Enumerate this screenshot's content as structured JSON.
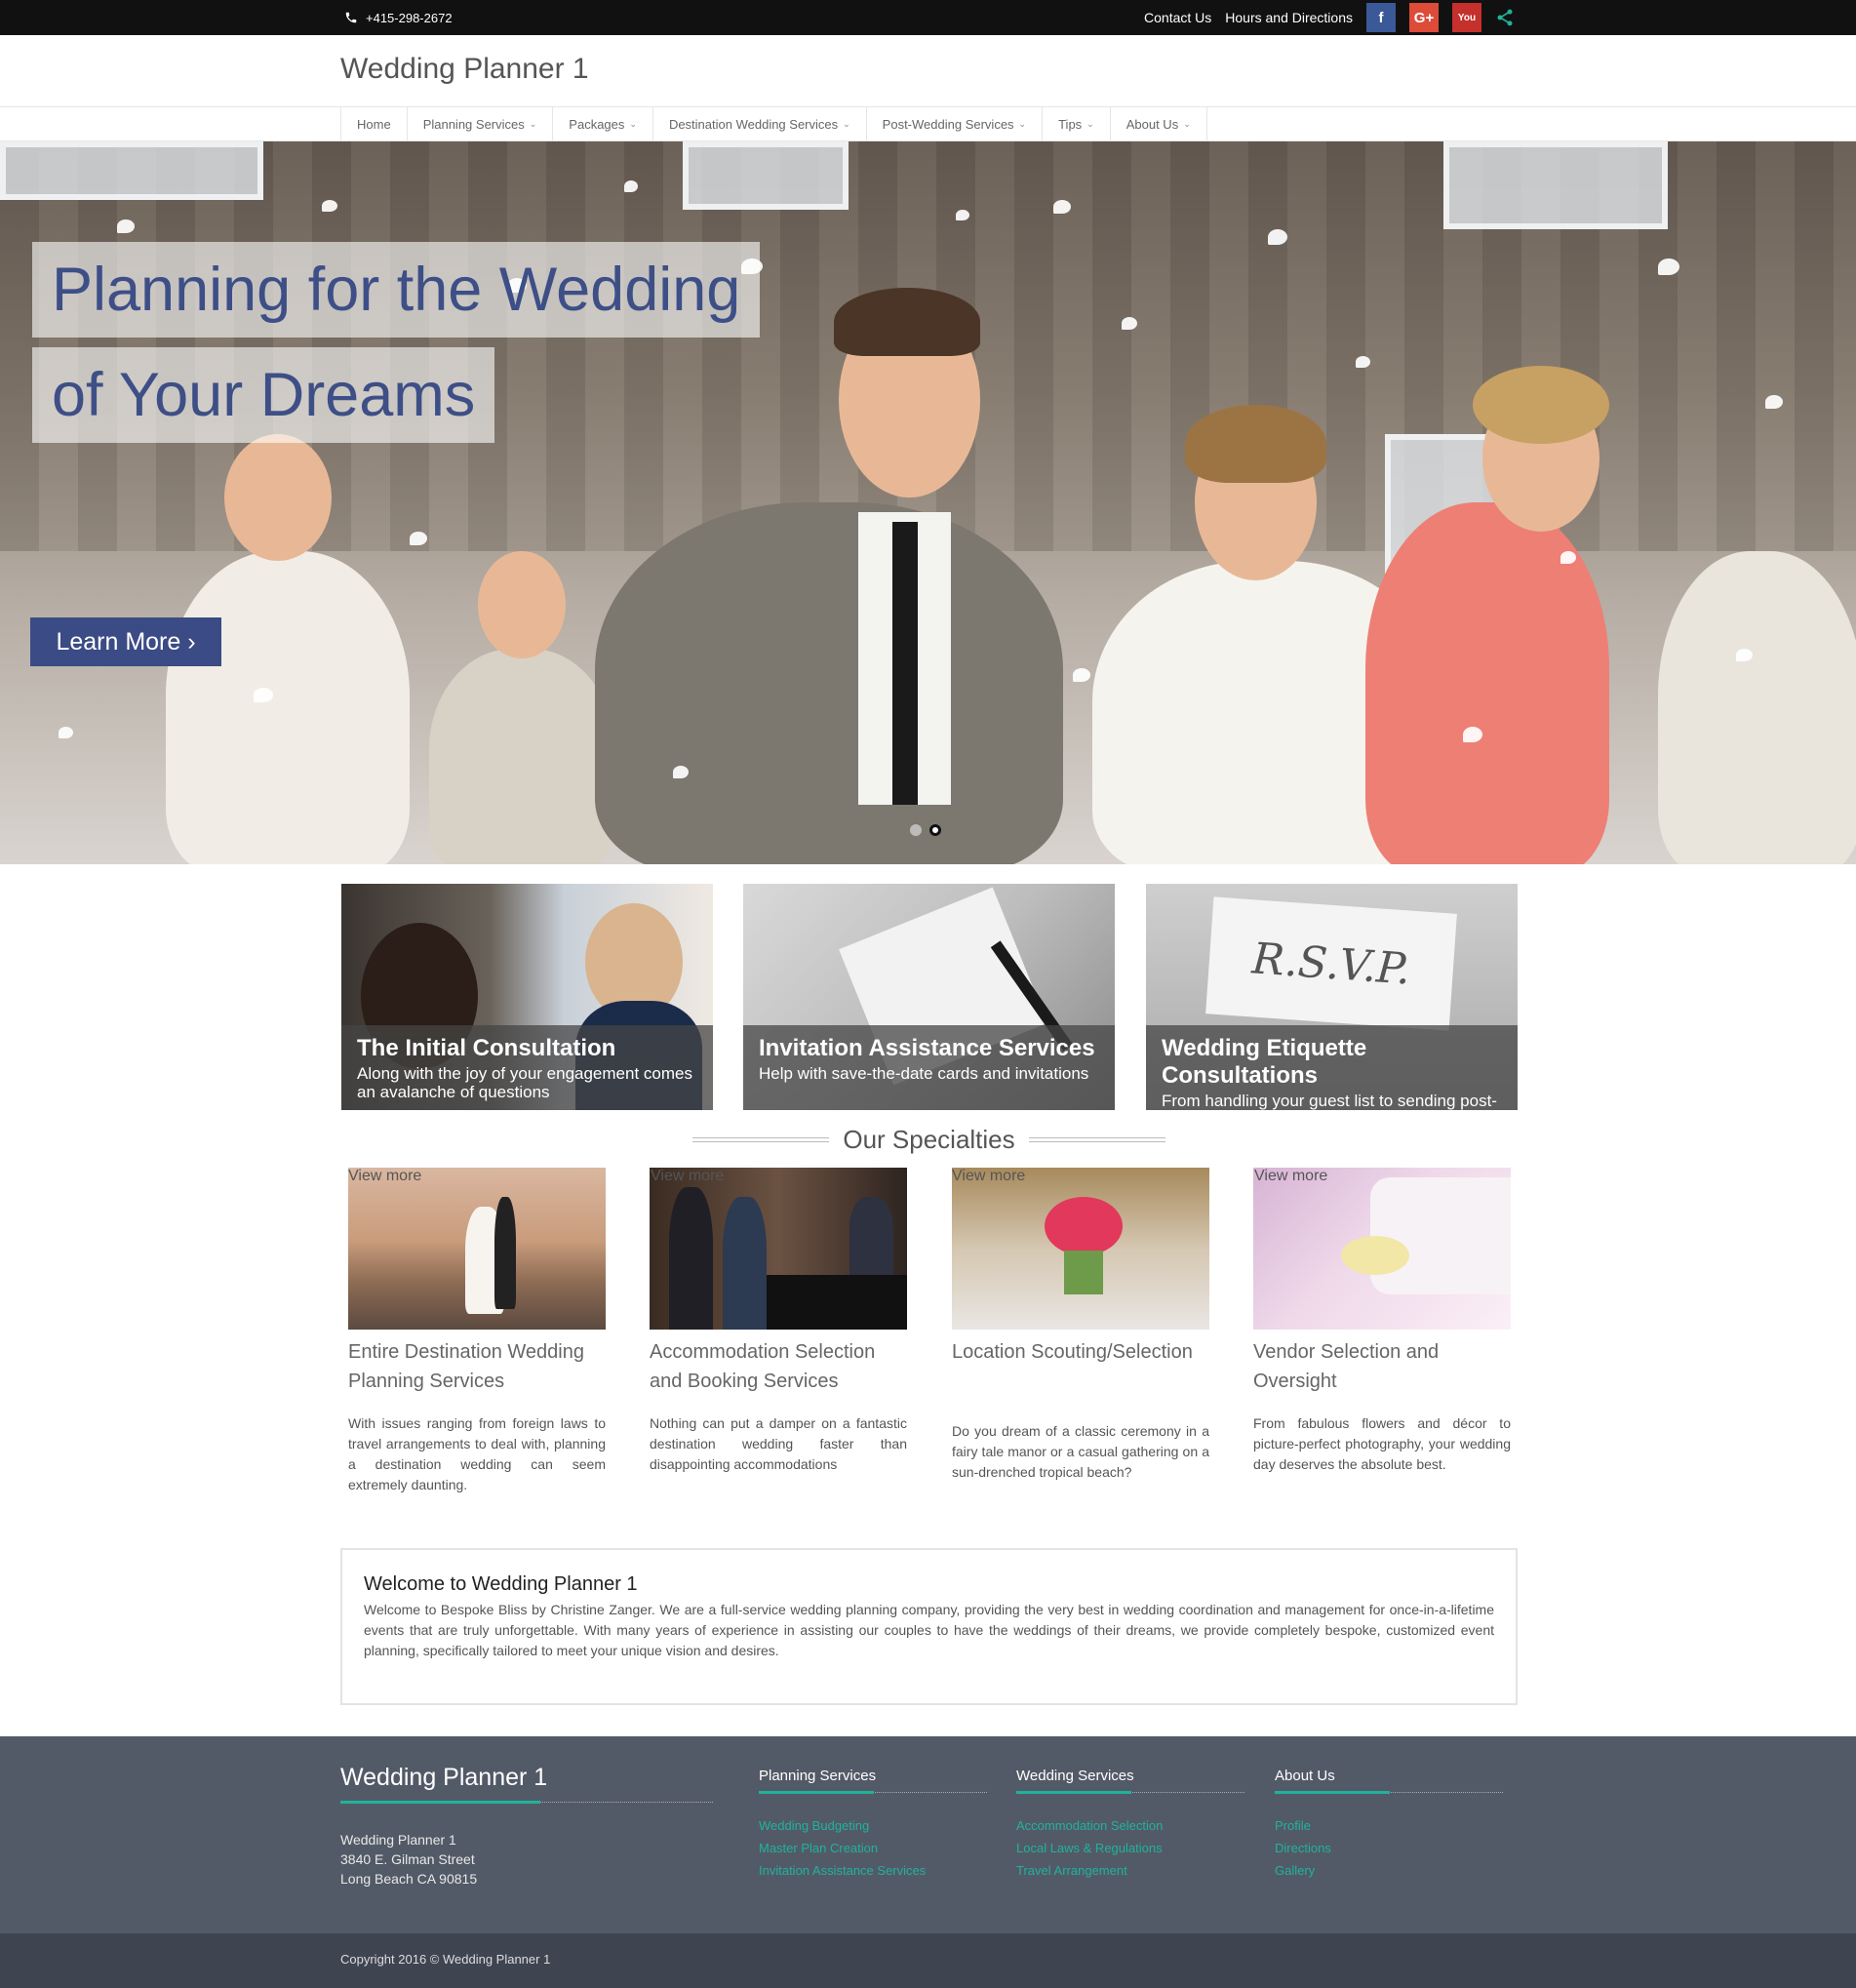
{
  "topbar": {
    "phone": "+415-298-2672",
    "links": [
      "Contact Us",
      "Hours and Directions"
    ],
    "social": {
      "facebook": "f",
      "google": "G+",
      "youtube": "You"
    }
  },
  "header": {
    "logo": "Wedding Planner 1"
  },
  "nav": [
    {
      "label": "Home",
      "dropdown": false
    },
    {
      "label": "Planning Services",
      "dropdown": true
    },
    {
      "label": "Packages",
      "dropdown": true
    },
    {
      "label": "Destination Wedding Services",
      "dropdown": true
    },
    {
      "label": "Post-Wedding Services",
      "dropdown": true
    },
    {
      "label": "Tips",
      "dropdown": true
    },
    {
      "label": "About Us",
      "dropdown": true
    }
  ],
  "hero": {
    "line1": "Planning for the Wedding",
    "line2": "of Your Dreams",
    "button": "Learn More ›"
  },
  "features": [
    {
      "title": "The Initial Consultation",
      "desc": "Along with the joy of your engagement comes an avalanche of questions"
    },
    {
      "title": "Invitation Assistance Services",
      "desc": "Help with save-the-date cards and invitations"
    },
    {
      "title": "Wedding Etiquette Consultations",
      "desc": "From handling your guest list to sending post-wedding thank you cards"
    }
  ],
  "rsvp_text": "R.S.V.P.",
  "specialties": {
    "title": "Our Specialties",
    "items": [
      {
        "title": "Entire Destination Wedding Planning Services",
        "desc": "With issues ranging from foreign laws to travel arrangements to deal with, planning a destination wedding can seem extremely daunting.",
        "button": "View more"
      },
      {
        "title": "Accommodation Selection and Booking Services",
        "desc": "Nothing can put a damper on a fantastic destination wedding faster than disappointing accommodations",
        "button": "View more"
      },
      {
        "title": "Location Scouting/Selection",
        "desc": "Do you dream of a classic ceremony in a fairy tale manor or a casual gathering on a sun-drenched tropical beach?",
        "button": "View more"
      },
      {
        "title": "Vendor Selection and Oversight",
        "desc": "From fabulous flowers and décor to picture-perfect photography, your wedding day deserves the absolute best.",
        "button": "View more"
      }
    ]
  },
  "welcome": {
    "title": "Welcome to Wedding Planner 1",
    "text": "Welcome to Bespoke Bliss by Christine Zanger. We are a full-service wedding planning company, providing the very best in wedding coordination and management for once-in-a-lifetime events that are truly unforgettable.  With many years of experience in assisting our couples to have the weddings of their dreams, we provide completely bespoke, customized event planning, specifically tailored to meet your unique vision and desires."
  },
  "footer": {
    "brand": "Wedding Planner 1",
    "address": [
      "Wedding Planner 1",
      "3840 E. Gilman Street",
      "Long Beach CA 90815"
    ],
    "columns": [
      {
        "title": "Planning Services",
        "links": [
          "Wedding Budgeting",
          "Master Plan Creation",
          "Invitation Assistance Services"
        ]
      },
      {
        "title": "Wedding Services",
        "links": [
          "Accommodation Selection",
          "Local Laws & Regulations",
          "Travel Arrangement"
        ]
      },
      {
        "title": "About Us",
        "links": [
          "Profile",
          "Directions",
          "Gallery"
        ]
      }
    ],
    "copyright": "Copyright 2016 © Wedding Planner 1"
  },
  "colors": {
    "accent": "#1fb29c",
    "hero_text": "#3d4f86",
    "button": "#3b4b85",
    "footer": "#535a67"
  }
}
